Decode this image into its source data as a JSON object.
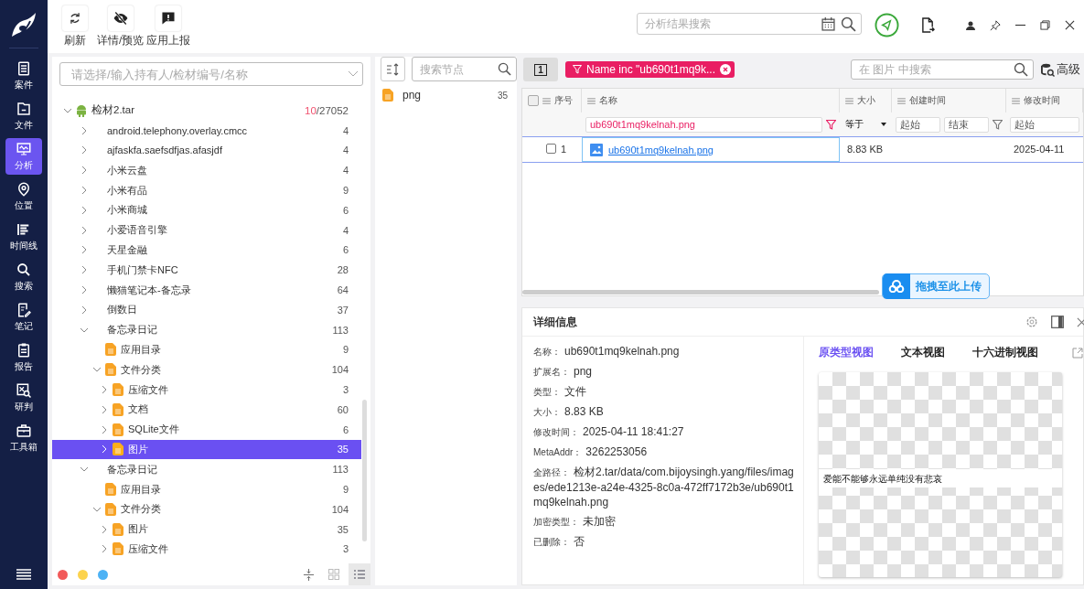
{
  "nav": {
    "items": [
      {
        "label": "案件",
        "kind": "case",
        "selected": false
      },
      {
        "label": "文件",
        "kind": "file",
        "selected": false
      },
      {
        "label": "分析",
        "kind": "analysis",
        "selected": true
      },
      {
        "label": "位置",
        "kind": "location",
        "selected": false
      },
      {
        "label": "时间线",
        "kind": "timeline",
        "selected": false
      },
      {
        "label": "搜索",
        "kind": "search",
        "selected": false
      },
      {
        "label": "笔记",
        "kind": "note",
        "selected": false
      },
      {
        "label": "报告",
        "kind": "report",
        "selected": false
      },
      {
        "label": "研判",
        "kind": "judge",
        "selected": false
      },
      {
        "label": "工具箱",
        "kind": "toolbox",
        "selected": false
      }
    ]
  },
  "toolbar": {
    "buttons": [
      {
        "label": "刷新",
        "kind": "refresh"
      },
      {
        "label": "详情/预览",
        "kind": "eye-off"
      },
      {
        "label": "应用上报",
        "kind": "alert"
      }
    ]
  },
  "search": {
    "placeholder": "分析结果搜索"
  },
  "evidence_select": {
    "placeholder": "请选择/输入持有人/检材编号/名称"
  },
  "tree": {
    "label": "检材2.tar",
    "kind": "device",
    "expanded": true,
    "count_hit": "10",
    "count_total": "/27052",
    "children": [
      {
        "label": "android.telephony.overlay.cmcc",
        "kind": "app",
        "expanded": false,
        "selected": false,
        "count": "4"
      },
      {
        "label": "ajfaskfa.saefsdfjas.afasjdf",
        "kind": "app",
        "expanded": false,
        "selected": false,
        "count": "4"
      },
      {
        "label": "小米云盘",
        "kind": "app",
        "expanded": false,
        "selected": false,
        "count": "4"
      },
      {
        "label": "小米有品",
        "kind": "app",
        "expanded": false,
        "selected": false,
        "count": "9"
      },
      {
        "label": "小米商城",
        "kind": "app",
        "expanded": false,
        "selected": false,
        "count": "6"
      },
      {
        "label": "小爱语音引擎",
        "kind": "app",
        "expanded": false,
        "selected": false,
        "count": "4"
      },
      {
        "label": "天星金融",
        "kind": "app",
        "expanded": false,
        "selected": false,
        "count": "6"
      },
      {
        "label": "手机门禁卡NFC",
        "kind": "app",
        "expanded": false,
        "selected": false,
        "count": "28"
      },
      {
        "label": "懒猫笔记本-备忘录",
        "kind": "app",
        "expanded": false,
        "selected": false,
        "count": "64"
      },
      {
        "label": "倒数日",
        "kind": "app",
        "expanded": false,
        "selected": false,
        "count": "37"
      },
      {
        "label": "备忘录日记",
        "kind": "app",
        "expanded": true,
        "selected": false,
        "count": "113",
        "children": [
          {
            "label": "应用目录",
            "kind": "leaf",
            "selected": false,
            "count": "9"
          },
          {
            "label": "文件分类",
            "kind": "folder",
            "expanded": true,
            "selected": false,
            "count": "104",
            "children": [
              {
                "label": "压缩文件",
                "kind": "folder",
                "expanded": false,
                "selected": false,
                "count": "3"
              },
              {
                "label": "文档",
                "kind": "folder",
                "expanded": false,
                "selected": false,
                "count": "60"
              },
              {
                "label": "SQLite文件",
                "kind": "folder",
                "expanded": false,
                "selected": false,
                "count": "6"
              },
              {
                "label": "图片",
                "kind": "folder",
                "expanded": false,
                "selected": true,
                "count": "35"
              }
            ]
          }
        ]
      },
      {
        "label": "备忘录日记",
        "kind": "app",
        "expanded": true,
        "selected": false,
        "count": "113",
        "children": [
          {
            "label": "应用目录",
            "kind": "leaf",
            "selected": false,
            "count": "9"
          },
          {
            "label": "文件分类",
            "kind": "folder",
            "expanded": true,
            "selected": false,
            "count": "104",
            "children": [
              {
                "label": "图片",
                "kind": "folder",
                "expanded": false,
                "selected": false,
                "count": "35"
              },
              {
                "label": "压缩文件",
                "kind": "folder",
                "expanded": false,
                "selected": false,
                "count": "3"
              }
            ]
          }
        ]
      }
    ]
  },
  "legend_dots": [
    {
      "color": "#f25a5a"
    },
    {
      "color": "#fcd34d"
    },
    {
      "color": "#4db2f5"
    }
  ],
  "view_modes": [
    {
      "kind": "collapse",
      "selected": false
    },
    {
      "kind": "grid",
      "selected": false
    },
    {
      "kind": "list",
      "selected": true
    }
  ],
  "node_search": {
    "placeholder": "搜索节点"
  },
  "nodes": [
    {
      "label": "png",
      "count": "35"
    }
  ],
  "page_badge": "1",
  "filter_chip": {
    "label": "Name inc \"ub690t1mq9k..."
  },
  "table_search": {
    "placeholder": "在 图片 中搜索"
  },
  "advanced": "高级",
  "table": {
    "columns": [
      "序号",
      "名称",
      "大小",
      "创建时间",
      "修改时间"
    ],
    "select_all_checked": false,
    "filters": {
      "name": "ub690t1mq9kelnah.png",
      "size_op": "等于",
      "created_from": {
        "placeholder": "起始"
      },
      "created_to": {
        "placeholder": "结束"
      },
      "modified_from": {
        "placeholder": "起始"
      }
    },
    "rows": [
      {
        "index": "1",
        "name": "ub690t1mq9kelnah.png",
        "size": "8.83 KB",
        "modified": "2025-04-11",
        "checked": false,
        "selected": true
      }
    ]
  },
  "upload_button": "拖拽至此上传",
  "detail": {
    "title": "详细信息",
    "fields": [
      {
        "label": "名称：",
        "value": "ub690t1mq9kelnah.png"
      },
      {
        "label": "扩展名：",
        "value": "png"
      },
      {
        "label": "类型：",
        "value": "文件"
      },
      {
        "label": "大小：",
        "value": "8.83 KB"
      },
      {
        "label": "修改时间：",
        "value": "2025-04-11 18:41:27"
      },
      {
        "label": "MetaAddr：",
        "value": "3262253056"
      },
      {
        "label": "全路径：",
        "value": "检材2.tar/data/com.bijoysingh.yang/files/images/ede1213e-a24e-4325-8c0a-472ff7172b3e/ub690t1mq9kelnah.png"
      },
      {
        "label": "加密类型：",
        "value": "未加密"
      },
      {
        "label": "已删除：",
        "value": "否"
      }
    ],
    "tabs": [
      {
        "label": "原类型视图",
        "selected": true
      },
      {
        "label": "文本视图",
        "selected": false
      },
      {
        "label": "十六进制视图",
        "selected": false
      }
    ],
    "preview_caption": "爱能不能够永远单纯没有悲哀"
  }
}
